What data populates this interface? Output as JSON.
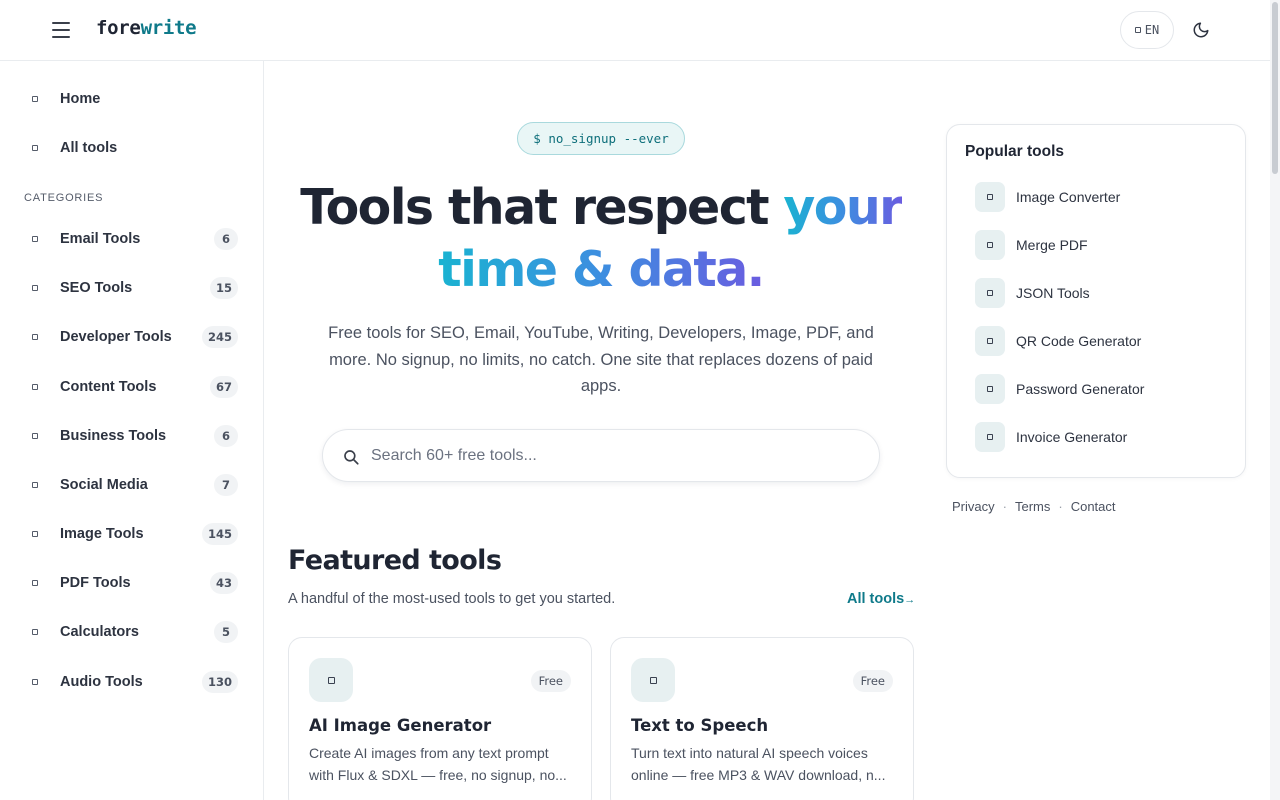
{
  "header": {
    "logo_main": "fore",
    "logo_accent": "write",
    "language": "EN"
  },
  "sidebar": {
    "main_items": [
      {
        "label": "Home"
      },
      {
        "label": "All tools"
      }
    ],
    "categories_heading": "CATEGORIES",
    "categories": [
      {
        "label": "Email Tools",
        "count": "6"
      },
      {
        "label": "SEO Tools",
        "count": "15"
      },
      {
        "label": "Developer Tools",
        "count": "245"
      },
      {
        "label": "Content Tools",
        "count": "67"
      },
      {
        "label": "Business Tools",
        "count": "6"
      },
      {
        "label": "Social Media",
        "count": "7"
      },
      {
        "label": "Image Tools",
        "count": "145"
      },
      {
        "label": "PDF Tools",
        "count": "43"
      },
      {
        "label": "Calculators",
        "count": "5"
      },
      {
        "label": "Audio Tools",
        "count": "130"
      }
    ]
  },
  "hero": {
    "badge": "$ no_signup --ever",
    "title_plain": "Tools that respect ",
    "title_accent_1": "your",
    "title_accent_2": "time & data.",
    "subtitle": "Free tools for SEO, Email, YouTube, Writing, Developers, Image, PDF, and more. No signup, no limits, no catch. One site that replaces dozens of paid apps.",
    "search_placeholder": "Search 60+ free tools..."
  },
  "featured": {
    "title": "Featured tools",
    "subtitle": "A handful of the most-used tools to get you started.",
    "all_link": "All tools",
    "all_link_arrow": "→",
    "cards": [
      {
        "badge": "Free",
        "title": "AI Image Generator",
        "description": "Create AI images from any text prompt with Flux & SDXL — free, no signup, no..."
      },
      {
        "badge": "Free",
        "title": "Text to Speech",
        "description": "Turn text into natural AI speech voices online — free MP3 & WAV download, n..."
      }
    ]
  },
  "popular": {
    "title": "Popular tools",
    "items": [
      {
        "label": "Image Converter"
      },
      {
        "label": "Merge PDF"
      },
      {
        "label": "JSON Tools"
      },
      {
        "label": "QR Code Generator"
      },
      {
        "label": "Password Generator"
      },
      {
        "label": "Invoice Generator"
      }
    ]
  },
  "footer": {
    "links": [
      "Privacy",
      "Terms",
      "Contact"
    ],
    "separator": "·"
  },
  "colors": {
    "accent": "#0f7a8a",
    "gradient_start": "#1ab3d1",
    "gradient_end": "#6a5ce0"
  }
}
